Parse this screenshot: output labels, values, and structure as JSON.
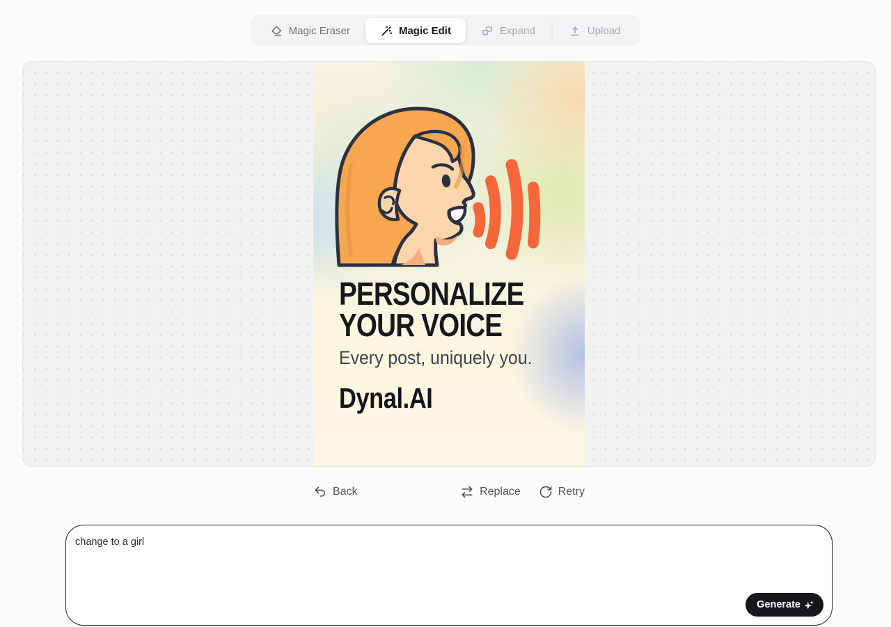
{
  "toolbar": {
    "tabs": [
      {
        "label": "Magic Eraser",
        "icon": "eraser-icon",
        "active": false
      },
      {
        "label": "Magic Edit",
        "icon": "magic-wand-icon",
        "active": true
      },
      {
        "label": "Expand",
        "icon": "expand-icon",
        "active": false
      },
      {
        "label": "Upload",
        "icon": "upload-icon",
        "active": false
      }
    ]
  },
  "poster": {
    "headline_line1": "PERSONALIZE",
    "headline_line2": "YOUR VOICE",
    "tagline": "Every post, uniquely you.",
    "brand": "Dynal.AI",
    "illustration": "woman-profile-speaking-with-sound-waves",
    "colors": {
      "hair": "#F6A74F",
      "skin": "#FCD6AB",
      "outline": "#2B3143",
      "sound_waves": "#F5673B",
      "background_cream": "#FAF6E2"
    }
  },
  "actions": {
    "back": "Back",
    "replace": "Replace",
    "retry": "Retry"
  },
  "prompt": {
    "value": "change to a girl",
    "generate_label": "Generate",
    "generate_icon": "sparkles-icon"
  },
  "canvas_style": {
    "background": "#F1F1F2",
    "dot_color": "#D7D7D9"
  }
}
